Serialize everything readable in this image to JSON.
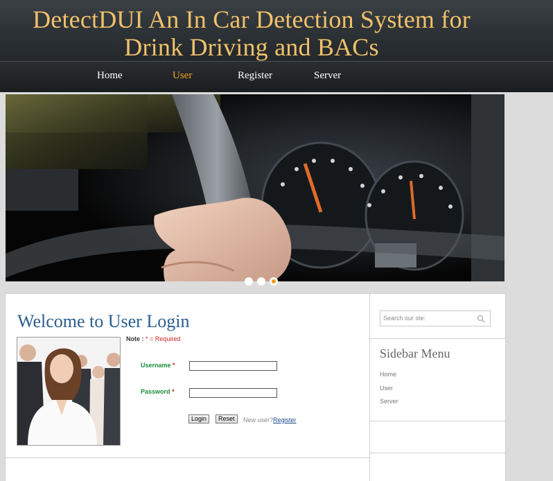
{
  "header": {
    "title_line1": "DetectDUI An In Car Detection System for",
    "title_line2": "Drink Driving and BACs",
    "title_color": "#f1c26a"
  },
  "nav": {
    "items": [
      {
        "label": "Home",
        "active": false
      },
      {
        "label": "User",
        "active": true
      },
      {
        "label": "Register",
        "active": false
      },
      {
        "label": "Server",
        "active": false
      }
    ],
    "active_color": "#f4a41d"
  },
  "slider": {
    "image": "hand on steering wheel with dashboard gauges",
    "slide_count": 3,
    "active_slide": 3
  },
  "login": {
    "title": "Welcome to User Login",
    "note_label": "Note :",
    "note_star": "*",
    "note_text": "= Required",
    "photo": "group of smiling business people",
    "username_label": "Username",
    "password_label": "Password",
    "required_mark": "*",
    "username_value": "",
    "password_value": "",
    "login_button": "Login",
    "reset_button": "Reset",
    "new_user_text": "New user?",
    "register_link": "Register"
  },
  "sidebar": {
    "search_placeholder": "Search our ste:",
    "title": "Sidebar Menu",
    "links": [
      "Home",
      "User",
      "Server"
    ]
  }
}
